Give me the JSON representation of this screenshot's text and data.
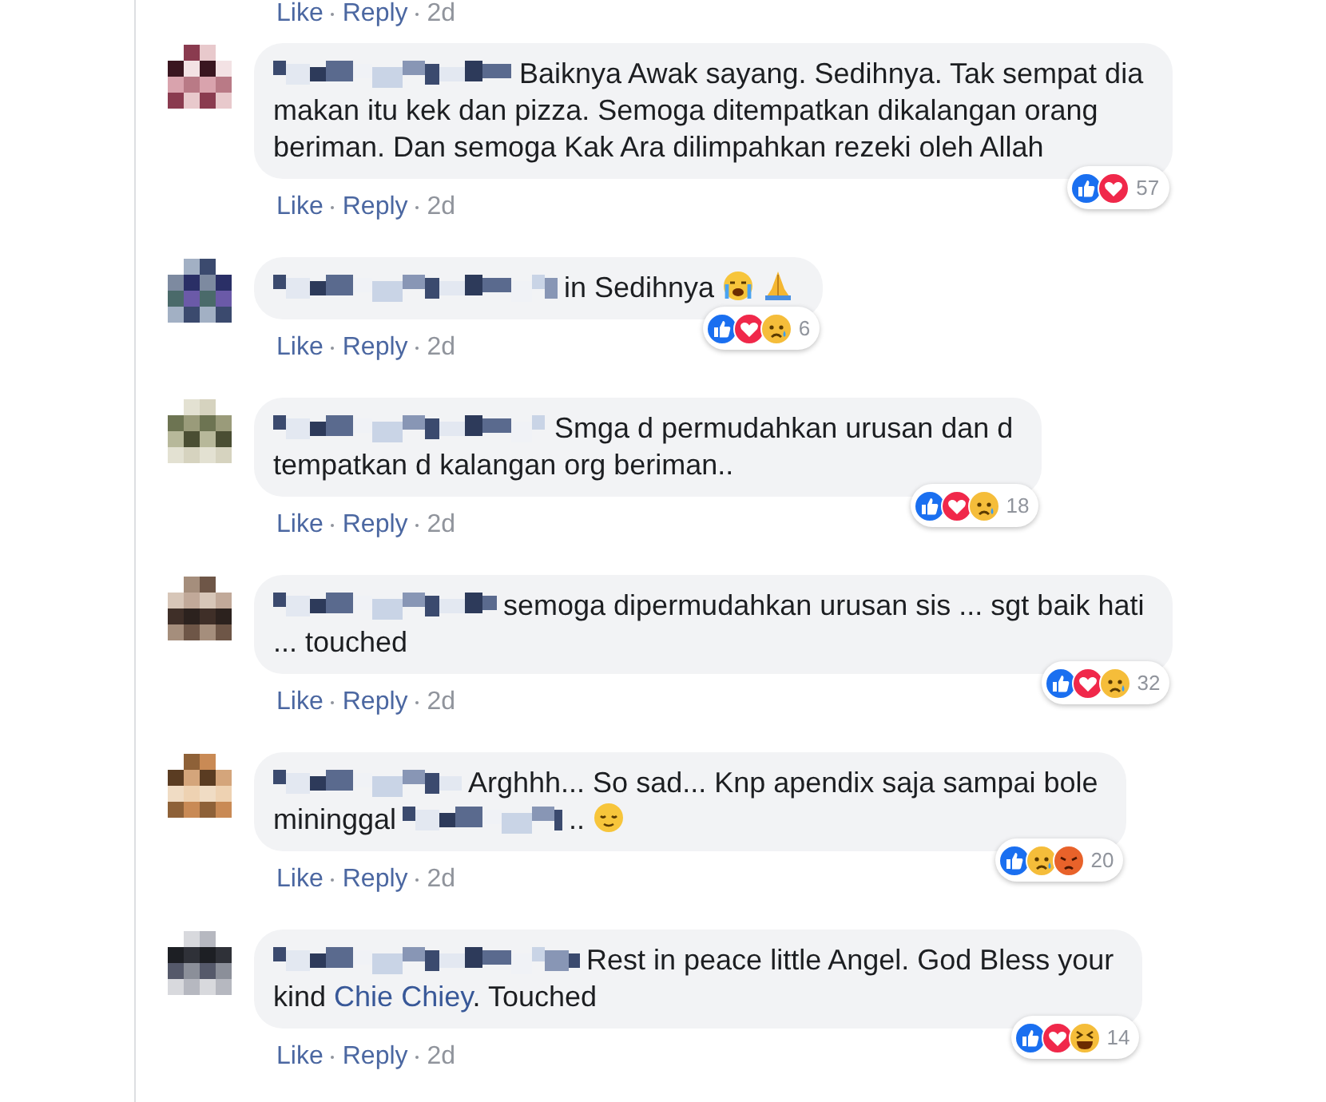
{
  "top_actions": {
    "like": "Like",
    "reply": "Reply",
    "time": "2d"
  },
  "comments": [
    {
      "lines": [
        [
          {
            "kind": "blur"
          },
          {
            "kind": "text",
            "text": "Baiknya Awak sayang. Sedihnya. Tak sempat dia"
          }
        ],
        [
          {
            "kind": "text",
            "text": "makan itu kek dan pizza. Semoga ditempatkan dikalangan orang"
          }
        ],
        [
          {
            "kind": "text",
            "text": "beriman. Dan semoga Kak Ara dilimpahkan rezeki oleh Allah"
          }
        ]
      ],
      "like": "Like",
      "reply": "Reply",
      "time": "2d",
      "reactions": [
        {
          "kind": "like"
        },
        {
          "kind": "love"
        }
      ],
      "count": "57"
    },
    {
      "lines": [
        [
          {
            "kind": "blur"
          },
          {
            "kind": "text",
            "text": "in Sedihnya"
          },
          {
            "kind": "crying_emoji"
          },
          {
            "kind": "praying_emoji"
          }
        ]
      ],
      "like": "Like",
      "reply": "Reply",
      "time": "2d",
      "reactions": [
        {
          "kind": "like"
        },
        {
          "kind": "love"
        },
        {
          "kind": "sad"
        }
      ],
      "count": "6"
    },
    {
      "lines": [
        [
          {
            "kind": "blur"
          },
          {
            "kind": "text",
            "text": "Smga d permudahkan urusan dan d"
          }
        ],
        [
          {
            "kind": "text",
            "text": "tempatkan d kalangan org beriman.."
          }
        ]
      ],
      "like": "Like",
      "reply": "Reply",
      "time": "2d",
      "reactions": [
        {
          "kind": "like"
        },
        {
          "kind": "love"
        },
        {
          "kind": "sad"
        }
      ],
      "count": "18"
    },
    {
      "lines": [
        [
          {
            "kind": "blur"
          },
          {
            "kind": "text",
            "text": "semoga dipermudahkan urusan sis ... sgt baik hati"
          }
        ],
        [
          {
            "kind": "text",
            "text": "... touched"
          }
        ]
      ],
      "like": "Like",
      "reply": "Reply",
      "time": "2d",
      "reactions": [
        {
          "kind": "like"
        },
        {
          "kind": "love"
        },
        {
          "kind": "sad"
        }
      ],
      "count": "32"
    },
    {
      "lines": [
        [
          {
            "kind": "blur"
          },
          {
            "kind": "text",
            "text": "Arghhh... So sad... Knp apendix saja sampai bole"
          }
        ],
        [
          {
            "kind": "text",
            "text": "mininggal"
          },
          {
            "kind": "blur"
          },
          {
            "kind": "text",
            "text": ".."
          },
          {
            "kind": "relieved_emoji"
          }
        ]
      ],
      "like": "Like",
      "reply": "Reply",
      "time": "2d",
      "reactions": [
        {
          "kind": "like"
        },
        {
          "kind": "sad"
        },
        {
          "kind": "angry"
        }
      ],
      "count": "20"
    },
    {
      "lines": [
        [
          {
            "kind": "blur"
          },
          {
            "kind": "text",
            "text": "Rest in peace little Angel. God Bless your"
          }
        ],
        [
          {
            "kind": "text",
            "text": "kind"
          },
          {
            "kind": "link",
            "text": "Chie Chiey"
          },
          {
            "kind": "text",
            "text": ". Touched"
          }
        ]
      ],
      "like": "Like",
      "reply": "Reply",
      "time": "2d",
      "reactions": [
        {
          "kind": "like"
        },
        {
          "kind": "love"
        },
        {
          "kind": "haha"
        }
      ],
      "count": "14"
    }
  ]
}
